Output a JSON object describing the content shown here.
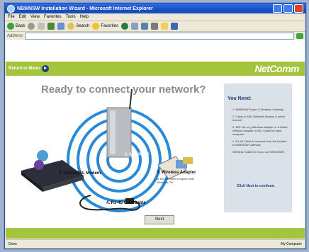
{
  "window": {
    "title": "NB9/NSW Installation Wizard - Microsoft Internet Explorer"
  },
  "menubar": [
    "File",
    "Edit",
    "View",
    "Favorites",
    "Tools",
    "Help"
  ],
  "toolbar": {
    "back_label": "Back",
    "search_label": "Search",
    "favorites_label": "Favorites"
  },
  "addressbar": {
    "label": "Address"
  },
  "page": {
    "return_label": "Return to Menu",
    "logo": "NetComm",
    "headline": "Ready to connect your network?",
    "labels": {
      "router": "1. NB9/NSW",
      "modem": "2. Cable/DSL Modem",
      "adapter": "3. Wireless Adapter",
      "adapter_sub": "or NIC for each computer with Windows OS",
      "cable": "4. RJ-45 Cat5 Cable"
    },
    "next_label": "Next",
    "panel": {
      "title": "You Need:",
      "items": [
        "1. NB9/NSW Super G Wireless Gateway",
        "2. Cable or DSL Ethernet Modem & active Internet",
        "3. 802.11b or g Wireless Adapter or a Wired Network Adapter or NIC Cable for each computer",
        "4. RJ-45 Cable to connect from the Modem to NB9/NSW Gateway",
        "Wireless Install CD if you use WINDOWS"
      ],
      "continue": "Click Next to continue."
    }
  },
  "status": {
    "left": "Done",
    "right": "My Computer"
  }
}
